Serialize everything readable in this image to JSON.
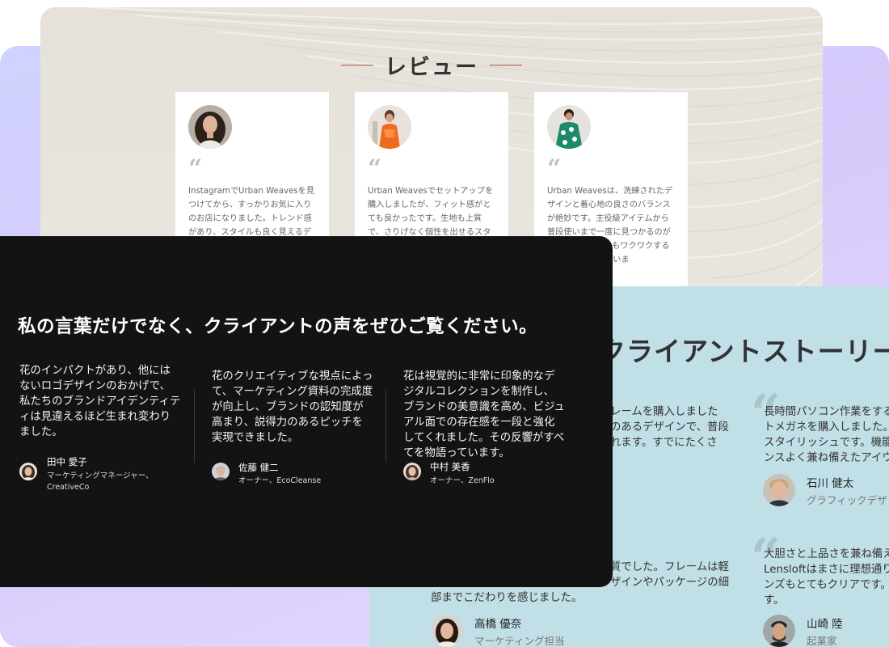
{
  "review": {
    "title": "レビュー",
    "cards": [
      {
        "text": "InstagramでUrban Weavesを見つけてから、すっかりお気に入りのお店になりました。トレンド感があり、スタイルも良く見えるデザインで、大満足な買い物ができ"
      },
      {
        "text": "Urban Weavesでセットアップを購入しましたが、フィット感がとても良かったです。生地も上質で、さりげなく個性を出せるスタイルが気に入っています。まだ"
      },
      {
        "text": "Urban Weavesは、洗練されたデザインと着心地の良さのバランスが絶妙です。主役級アイテムから普段使いまで一度に見つかるのが嬉しいです。いつもワクワクするショッピングしていま"
      }
    ]
  },
  "dark": {
    "title": "私の言葉だけでなく、クライアントの声をぜひご覧ください。",
    "testimonials": [
      {
        "text": "花のインパクトがあり、他にはないロゴデザインのおかげで、私たちのブランドアイデンティティは見違えるほど生まれ変わりました。",
        "name": "田中 愛子",
        "role": "マーケティングマネージャー、CreativeCo"
      },
      {
        "text": "花のクリエイティブな視点によって、マーケティング資料の完成度が向上し、ブランドの認知度が高まり、説得力のあるピッチを実現できました。",
        "name": "佐藤 健二",
        "role": "オーナー、EcoCleanse"
      },
      {
        "text": "花は視覚的に非常に印象的なデジタルコレクションを制作し、ブランドの美意識を高め、ビジュアル面での存在感を一段と強化してくれました。その反響がすべてを物語っています。",
        "name": "中村 美香",
        "role": "オーナー、ZenFlo"
      }
    ]
  },
  "blue": {
    "title": "クライアントストーリー",
    "left_top": {
      "lines": [
        "レームを購入しました",
        "のあるデザインで、普段",
        "れます。すでにたくさ"
      ]
    },
    "right_top": {
      "lines": [
        "長時間パソコン作業をする",
        "トメガネを購入しました。",
        "スタイリッシュです。機能性",
        "ンスよく兼ね備えたアイウ"
      ],
      "name": "石川 健太",
      "role": "グラフィックデザ"
    },
    "left_bottom": {
      "lines": [
        "質でした。フレームは軽",
        "ザインやパッケージの細",
        "部までこだわりを感じました。"
      ],
      "name": "高橋 優奈",
      "role": "マーケティング担当"
    },
    "right_bottom": {
      "lines": [
        "大胆さと上品さを兼ね備え",
        "Lensloftはまさに理想通り",
        "ンズもとてもクリアです。",
        "す。"
      ],
      "name": "山崎 陸",
      "role": "起業家"
    }
  },
  "colors": {
    "accent_rule": "#b5533e",
    "dark_bg": "#131313",
    "blue_bg": "#c1dfe6",
    "beige_bg": "#e6e2da"
  }
}
